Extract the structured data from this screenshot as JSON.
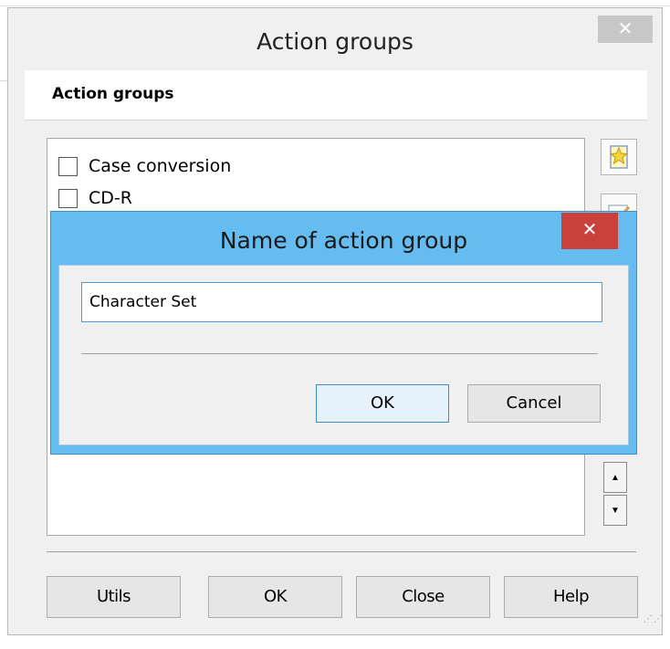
{
  "outer_dialog": {
    "title": "Action groups",
    "close_glyph": "✕",
    "header": "Action groups",
    "list_items": [
      {
        "label": "Case conversion",
        "checked": false
      },
      {
        "label": "CD-R",
        "checked": false
      }
    ],
    "side_buttons": [
      "new-star-icon",
      "edit-icon",
      "copy-icon",
      "delete-icon"
    ],
    "scroll_up_glyph": "▲",
    "scroll_down_glyph": "▼",
    "buttons": {
      "utils": "Utils",
      "ok": "OK",
      "close": "Close",
      "help": "Help"
    }
  },
  "modal": {
    "title": "Name of action group",
    "close_glyph": "✕",
    "input_value": "Character Set",
    "buttons": {
      "ok": "OK",
      "cancel": "Cancel"
    }
  },
  "colors": {
    "modal_accent": "#65bcf0",
    "modal_close": "#c9413a",
    "input_focus": "#4a9be0"
  }
}
